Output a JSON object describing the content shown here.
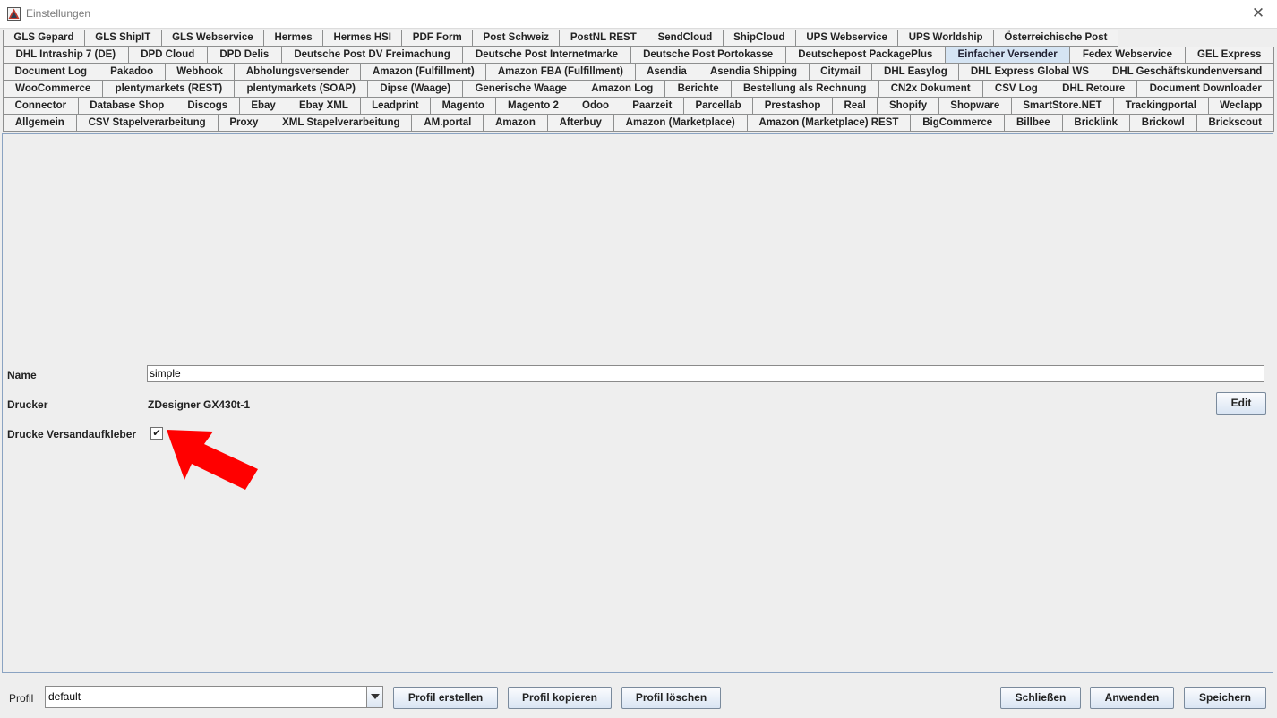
{
  "window": {
    "title": "Einstellungen",
    "close_glyph": "✕"
  },
  "tabs": {
    "selected": "Einfacher Versender",
    "rows": [
      [
        "GLS Gepard",
        "GLS ShipIT",
        "GLS Webservice",
        "Hermes",
        "Hermes HSI",
        "PDF Form",
        "Post Schweiz",
        "PostNL REST",
        "SendCloud",
        "ShipCloud",
        "UPS Webservice",
        "UPS Worldship",
        "Österreichische Post"
      ],
      [
        "DHL Intraship 7 (DE)",
        "DPD Cloud",
        "DPD Delis",
        "Deutsche Post DV Freimachung",
        "Deutsche Post Internetmarke",
        "Deutsche Post Portokasse",
        "Deutschepost PackagePlus",
        "Einfacher Versender",
        "Fedex Webservice",
        "GEL Express"
      ],
      [
        "Document Log",
        "Pakadoo",
        "Webhook",
        "Abholungsversender",
        "Amazon (Fulfillment)",
        "Amazon FBA (Fulfillment)",
        "Asendia",
        "Asendia Shipping",
        "Citymail",
        "DHL Easylog",
        "DHL Express Global WS",
        "DHL Geschäftskundenversand"
      ],
      [
        "WooCommerce",
        "plentymarkets (REST)",
        "plentymarkets (SOAP)",
        "Dipse (Waage)",
        "Generische Waage",
        "Amazon Log",
        "Berichte",
        "Bestellung als Rechnung",
        "CN2x Dokument",
        "CSV Log",
        "DHL Retoure",
        "Document Downloader"
      ],
      [
        "Connector",
        "Database Shop",
        "Discogs",
        "Ebay",
        "Ebay XML",
        "Leadprint",
        "Magento",
        "Magento 2",
        "Odoo",
        "Paarzeit",
        "Parcellab",
        "Prestashop",
        "Real",
        "Shopify",
        "Shopware",
        "SmartStore.NET",
        "Trackingportal",
        "Weclapp"
      ],
      [
        "Allgemein",
        "CSV Stapelverarbeitung",
        "Proxy",
        "XML Stapelverarbeitung",
        "AM.portal",
        "Amazon",
        "Afterbuy",
        "Amazon (Marketplace)",
        "Amazon (Marketplace) REST",
        "BigCommerce",
        "Billbee",
        "Bricklink",
        "Brickowl",
        "Brickscout"
      ]
    ]
  },
  "form": {
    "name_label": "Name",
    "name_value": "simple",
    "drucker_label": "Drucker",
    "drucker_value": "ZDesigner GX430t-1",
    "edit_button": "Edit",
    "versandaufkleber_label": "Drucke Versandaufkleber",
    "versandaufkleber_checked": true,
    "check_glyph": "✔"
  },
  "annotation": {
    "arrow_color": "#ff0000"
  },
  "footer": {
    "profil_label": "Profil",
    "profil_value": "default",
    "profil_erstellen": "Profil erstellen",
    "profil_kopieren": "Profil kopieren",
    "profil_loeschen": "Profil löschen",
    "schliessen": "Schließen",
    "anwenden": "Anwenden",
    "speichern": "Speichern"
  },
  "colors": {
    "selected_tab": "#d5e4f3",
    "panel_border": "#8aa3c2"
  }
}
